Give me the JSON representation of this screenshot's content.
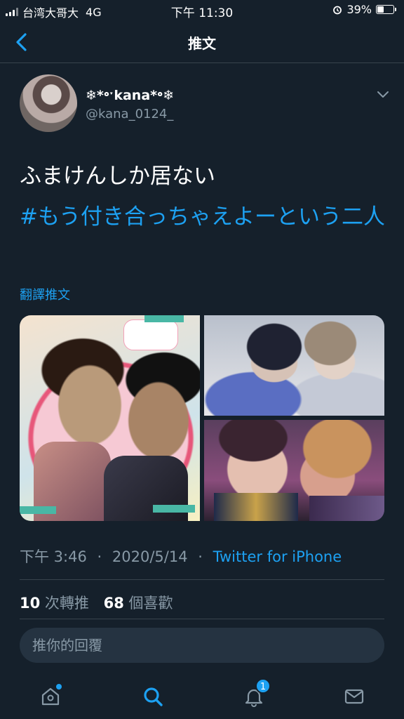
{
  "status_bar": {
    "carrier": "台湾大哥大",
    "network": "4G",
    "time": "下午 11:30",
    "battery": "39%",
    "battery_level": 0.39
  },
  "nav": {
    "title": "推文",
    "back_icon": "chevron-left-icon"
  },
  "tweet": {
    "display_name": "❄*॰ˑkana*॰❄",
    "username": "@kana_0124_",
    "text_line": "ふまけんしか居ない",
    "hashtag": "#もう付き合っちゃえよーという二人",
    "translate_label": "翻譯推文",
    "images": [
      "photo-1",
      "photo-2",
      "photo-3"
    ],
    "time": "下午 3:46",
    "date": "2020/5/14",
    "separator": "·",
    "source": "Twitter for iPhone",
    "retweets_count": "10",
    "retweets_label": "次轉推",
    "likes_count": "68",
    "likes_label": "個喜歡"
  },
  "reply": {
    "placeholder": "推你的回覆"
  },
  "tabbar": {
    "items": [
      {
        "icon": "home-icon",
        "has_dot": true
      },
      {
        "icon": "search-icon",
        "active": true
      },
      {
        "icon": "bell-icon",
        "badge": "1"
      },
      {
        "icon": "mail-icon"
      }
    ]
  },
  "colors": {
    "background": "#15202b",
    "accent": "#1da1f2",
    "secondary_text": "#8899a6",
    "divider": "#38444d"
  }
}
